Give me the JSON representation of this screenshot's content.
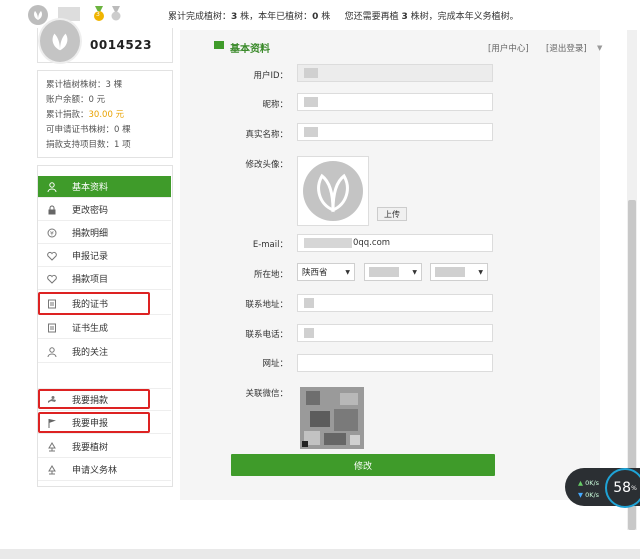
{
  "topbar": {
    "badge_count": "3",
    "stats_pre": "累计完成植树：",
    "stats_num1": "3",
    "stats_mid1": " 株，本年已植树：",
    "stats_num2": "0",
    "stats_mid2": " 株     您还需要再植 ",
    "stats_num3": "3",
    "stats_post": " 株树，完成本年义务植树。"
  },
  "profile": {
    "user_number": "0014523"
  },
  "stats": {
    "trees_label": "累计植树株树：",
    "trees_value": "3 棵",
    "balance_label": "账户余额：",
    "balance_value": "0 元",
    "donation_label": "累计捐款：",
    "donation_value": "30.00 元",
    "cert_label": "可申请证书株树：",
    "cert_value": "0 棵",
    "projects_label": "捐款支持项目数：",
    "projects_value": "1 项"
  },
  "menu": {
    "items": [
      {
        "label": "基本资料",
        "icon": "user-icon"
      },
      {
        "label": "更改密码",
        "icon": "lock-icon"
      },
      {
        "label": "捐款明细",
        "icon": "coin-icon"
      },
      {
        "label": "申报记录",
        "icon": "heart-icon"
      },
      {
        "label": "捐款项目",
        "icon": "heart-icon"
      },
      {
        "label": "我的证书",
        "icon": "certificate-icon"
      },
      {
        "label": "证书生成",
        "icon": "document-icon"
      },
      {
        "label": "我的关注",
        "icon": "user-icon"
      },
      {
        "label": "我要捐款",
        "icon": "donate-icon"
      },
      {
        "label": "我要申报",
        "icon": "flag-icon"
      },
      {
        "label": "我要植树",
        "icon": "tree-icon"
      },
      {
        "label": "申请义务林",
        "icon": "tree-icon"
      }
    ]
  },
  "main": {
    "section_title": "基本资料",
    "user_center": "[用户中心]",
    "logout": "[退出登录]",
    "fields": {
      "user_id_label": "用户ID：",
      "nickname_label": "昵称：",
      "realname_label": "真实名称：",
      "avatar_label": "修改头像：",
      "upload_button": "上传",
      "email_label": "E-mail：",
      "email_value": "0qq.com",
      "location_label": "所在地：",
      "province_value": "陕西省",
      "address_label": "联系地址：",
      "phone_label": "联系电话：",
      "website_label": "网址：",
      "wechat_label": "关联微信："
    },
    "submit_button": "修改"
  },
  "widget": {
    "upload_speed": "0K/s",
    "download_speed": "0K/s",
    "percent": "58"
  },
  "colors": {
    "brand_green": "#3f9b2a",
    "highlight_red": "#d22222",
    "accent_orange": "#e8a200"
  }
}
